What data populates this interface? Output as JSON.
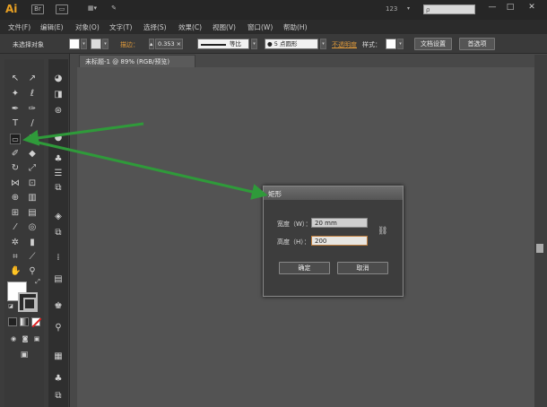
{
  "app": {
    "logo": "Ai"
  },
  "titlebar": {
    "zoom_value": "123",
    "search_placeholder": "ρ",
    "minimize": "—",
    "maximize": "□",
    "close": "✕"
  },
  "menu": [
    "文件(F)",
    "编辑(E)",
    "对象(O)",
    "文字(T)",
    "选择(S)",
    "效果(C)",
    "视图(V)",
    "窗口(W)",
    "帮助(H)"
  ],
  "control": {
    "no_selection": "未选择对象",
    "stroke_label": "描边：",
    "stroke_value": "0.353 ×",
    "profile": "等比",
    "brush": "● 5 点圆形",
    "opacity_label": "不透明度",
    "style_label": "样式：",
    "doc_setup": "文档设置",
    "prefs": "首选项"
  },
  "document": {
    "tab_title": "未标题-1 @ 89% (RGB/预览)"
  },
  "dialog": {
    "title": "矩形",
    "width_label": "宽度（W）：",
    "width_value": "20 mm",
    "height_label": "高度（H）：",
    "height_value": "200",
    "ok": "确定",
    "cancel": "取消"
  },
  "colors": {
    "accent_orange": "#e8a023",
    "arrow_green": "#2f9a3a"
  }
}
